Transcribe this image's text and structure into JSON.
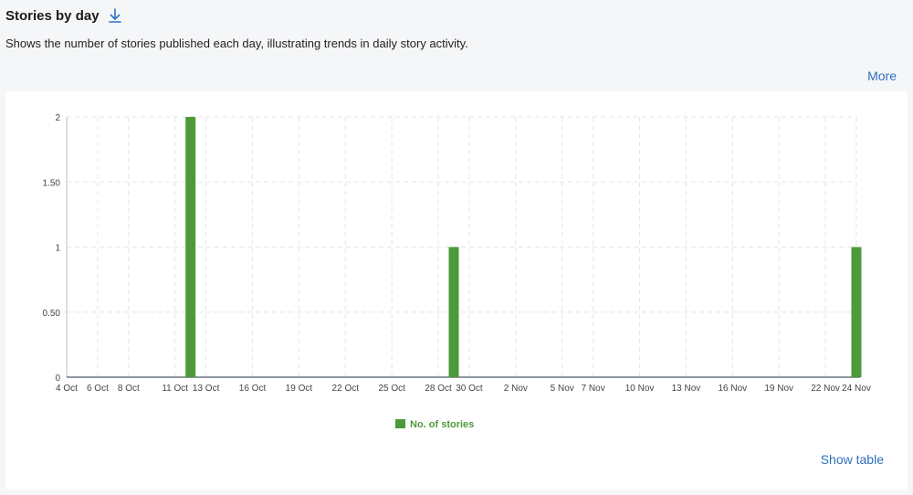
{
  "header": {
    "title": "Stories by day",
    "description": "Shows the number of stories published each day, illustrating trends in daily story activity.",
    "more_label": "More",
    "show_table_label": "Show table",
    "download_icon": "download-arrow-icon"
  },
  "colors": {
    "bar": "#4c9a3a",
    "link": "#2f6fbd",
    "legend_text": "#4c9a3a"
  },
  "chart_data": {
    "type": "bar",
    "x_range": [
      "2024-10-04",
      "2024-11-24"
    ],
    "tick_labels": [
      "4 Oct",
      "6 Oct",
      "8 Oct",
      "11 Oct",
      "13 Oct",
      "16 Oct",
      "19 Oct",
      "22 Oct",
      "25 Oct",
      "28 Oct",
      "30 Oct",
      "2 Nov",
      "5 Nov",
      "7 Nov",
      "10 Nov",
      "13 Nov",
      "16 Nov",
      "19 Nov",
      "22 Nov",
      "24 Nov"
    ],
    "tick_dates": [
      "2024-10-04",
      "2024-10-06",
      "2024-10-08",
      "2024-10-11",
      "2024-10-13",
      "2024-10-16",
      "2024-10-19",
      "2024-10-22",
      "2024-10-25",
      "2024-10-28",
      "2024-10-30",
      "2024-11-02",
      "2024-11-05",
      "2024-11-07",
      "2024-11-10",
      "2024-11-13",
      "2024-11-16",
      "2024-11-19",
      "2024-11-22",
      "2024-11-24"
    ],
    "y_ticks": [
      "0",
      "0.50",
      "1",
      "1.50",
      "2"
    ],
    "ylim": [
      0,
      2
    ],
    "grid": true,
    "legend_position": "bottom-center",
    "series": [
      {
        "name": "No. of stories",
        "points": [
          {
            "x": "2024-10-12",
            "y": 2
          },
          {
            "x": "2024-10-29",
            "y": 1
          },
          {
            "x": "2024-11-24",
            "y": 1
          }
        ]
      }
    ]
  }
}
